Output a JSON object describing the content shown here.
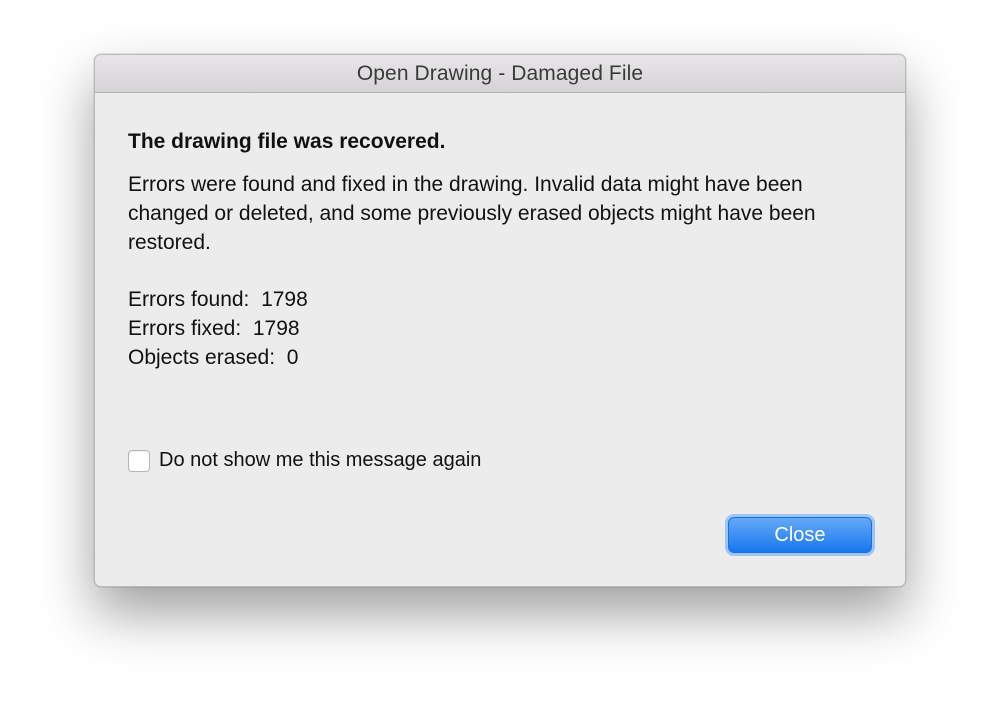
{
  "dialog": {
    "title": "Open Drawing - Damaged File",
    "headline": "The drawing file was recovered.",
    "body": "Errors were found and fixed in the drawing. Invalid data might have been changed or deleted, and some previously erased objects might have been restored.",
    "stats": [
      {
        "label": "Errors found:",
        "value": "1798"
      },
      {
        "label": "Errors fixed:",
        "value": "1798"
      },
      {
        "label": "Objects erased:",
        "value": "0"
      }
    ],
    "checkbox_label": "Do not show me this message again",
    "checkbox_checked": false,
    "close_label": "Close",
    "accent_color": "#1877f0"
  }
}
